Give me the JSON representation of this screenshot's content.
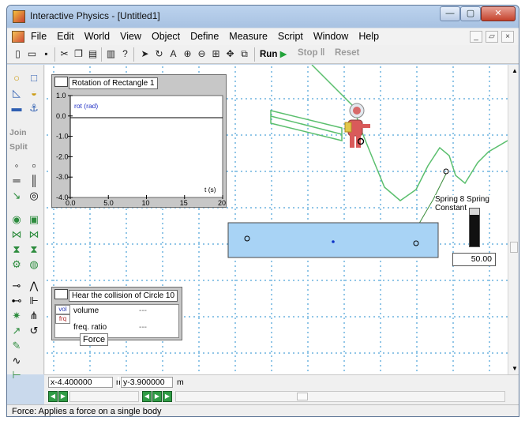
{
  "window": {
    "title": "Interactive Physics - [Untitled1]",
    "controls": {
      "minimize": "—",
      "maximize": "▢",
      "close": "✕"
    }
  },
  "menu": {
    "items": [
      "File",
      "Edit",
      "World",
      "View",
      "Object",
      "Define",
      "Measure",
      "Script",
      "Window",
      "Help"
    ],
    "mdi": {
      "minimize": "_",
      "restore": "▱",
      "close": "×"
    }
  },
  "toolbar": {
    "run": "Run",
    "stop": "Stop",
    "reset": "Reset"
  },
  "palette": {
    "join": "Join",
    "split": "Split",
    "tooltip": "Force"
  },
  "graph": {
    "title": "Rotation of Rectangle 1",
    "series_name": "rot (rad)",
    "x_label": "t (s)",
    "y_ticks": [
      "1.0",
      "0.0",
      "-1.0",
      "-2.0",
      "-3.0",
      "-4.0"
    ],
    "x_ticks": [
      "0.0",
      "5.0",
      "10",
      "15",
      "20"
    ]
  },
  "meter": {
    "title": "Hear the collision of Circle 10",
    "btn_vol": "vol",
    "btn_freq": "frq",
    "rows": [
      {
        "label": "volume",
        "value": "---"
      },
      {
        "label": "freq. ratio",
        "value": "---"
      }
    ]
  },
  "control": {
    "label": "Spring 8 Spring Constant",
    "value": "50.00"
  },
  "coords": {
    "x_label": "x",
    "x_value": "-4.400000",
    "x_unit": "m",
    "y_label": "y",
    "y_value": "-3.900000",
    "y_unit": "m"
  },
  "status": {
    "text": "Force:  Applies a force on a single body"
  },
  "chart_data": {
    "type": "line",
    "title": "Rotation of Rectangle 1",
    "xlabel": "t (s)",
    "ylabel": "rot (rad)",
    "xlim": [
      0,
      20
    ],
    "ylim": [
      -4,
      1
    ],
    "series": [
      {
        "name": "rot (rad)",
        "x": [],
        "y": []
      }
    ]
  }
}
